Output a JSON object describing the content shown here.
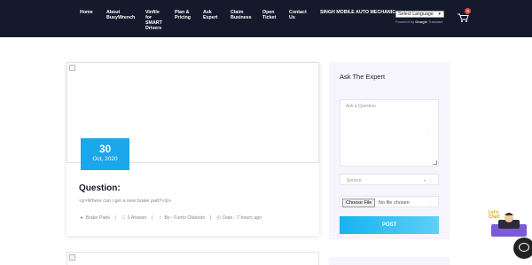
{
  "nav": {
    "items": [
      {
        "l1": "Home",
        "l2": ""
      },
      {
        "l1": "About",
        "l2": "BusyWrench"
      },
      {
        "l1": "Vinfile",
        "l2": "for",
        "l3": "SMART",
        "l4": "Drivers"
      },
      {
        "l1": "Plan &",
        "l2": "Pricing"
      },
      {
        "l1": "Ask",
        "l2": "Expert"
      },
      {
        "l1": "Claim",
        "l2": "Business"
      },
      {
        "l1": "Open",
        "l2": "Ticket"
      },
      {
        "l1": "Contact",
        "l2": "Us"
      },
      {
        "l1": "SINGH MOBILE AUTO MECHANIC",
        "l2": ""
      }
    ],
    "language_select": "Select Language",
    "powered_by": "Powered by",
    "google": "Google",
    "translate": "Translate",
    "cart_count": "0",
    "colors": {
      "nav_bg": "#14192b",
      "badge": "#e94b3c"
    }
  },
  "post": {
    "date_day": "30",
    "date_month": "Oct, 2020",
    "title": "Question:",
    "body": "<p>Where can i get a new brake pad?</p>",
    "category": "Brake Pads",
    "answers": "0 Answer",
    "author": "By - Funto Olabode",
    "date": "Date - 7 hours ago",
    "accent": "#1aa7ec"
  },
  "sidebar": {
    "title": "Ask The Expert",
    "question_placeholder": "Ask a Question",
    "service_placeholder": "Service",
    "file_button": "Choose File",
    "file_status": "No file chosen",
    "post_button": "POST"
  },
  "chat": {
    "label_1": "Let's",
    "label_2": "Chat!"
  }
}
